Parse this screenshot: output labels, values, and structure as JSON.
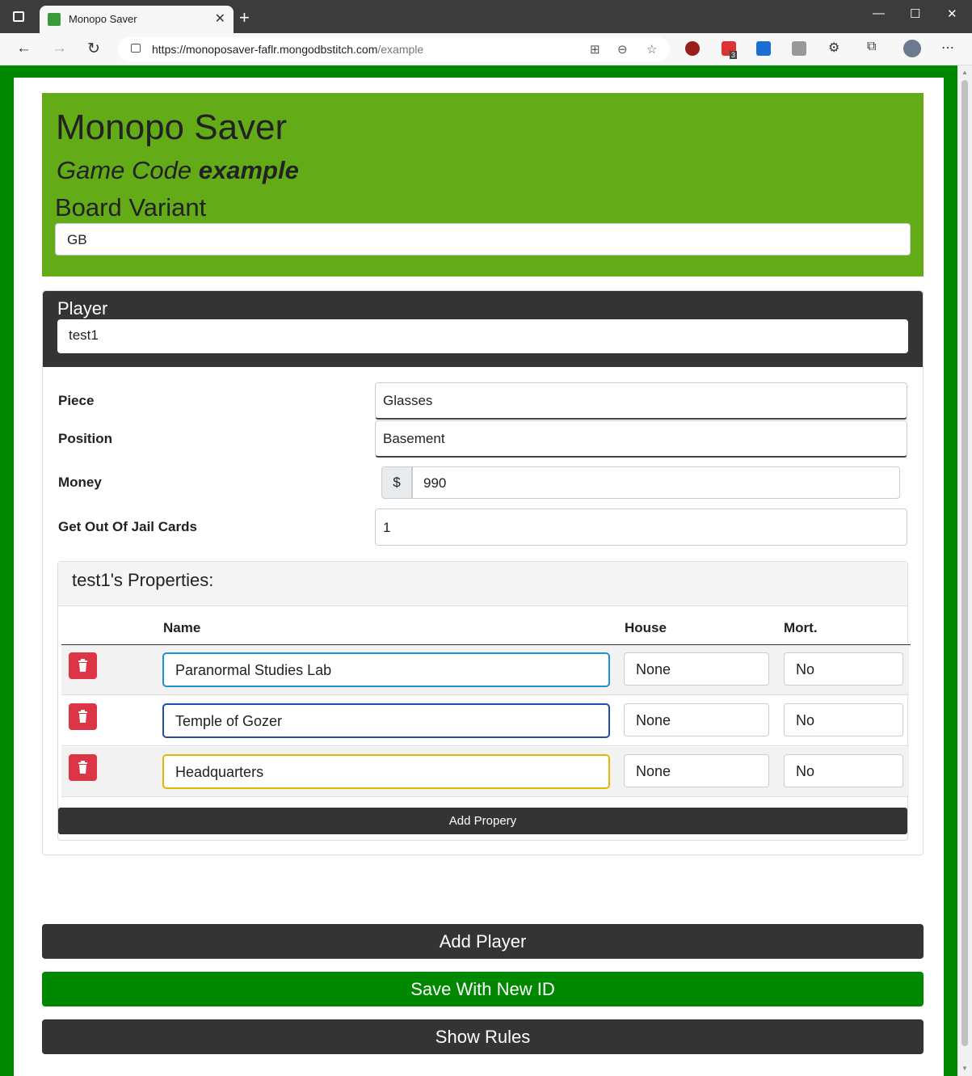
{
  "browser": {
    "tab_title": "Monopo Saver",
    "url_host": "https://monoposaver-faflr.mongodbstitch.com",
    "url_path": "/example",
    "extension_badge": "3"
  },
  "app": {
    "title": "Monopo Saver",
    "game_code_label": "Game Code",
    "game_code": "example",
    "board_variant_label": "Board Variant",
    "board_variant": "GB"
  },
  "player": {
    "label": "Player",
    "name": "test1",
    "piece_label": "Piece",
    "piece": "Glasses",
    "position_label": "Position",
    "position": "Basement",
    "money_label": "Money",
    "money_prefix": "$",
    "money": "990",
    "jail_label": "Get Out Of Jail Cards",
    "jail_cards": "1",
    "properties_title": "test1's Properties:",
    "columns": {
      "name": "Name",
      "house": "House",
      "mort": "Mort."
    },
    "properties": [
      {
        "name": "Paranormal Studies Lab",
        "house": "None",
        "mort": "No",
        "border": "#1e90d6"
      },
      {
        "name": "Temple of Gozer",
        "house": "None",
        "mort": "No",
        "border": "#1e4fa0"
      },
      {
        "name": "Headquarters",
        "house": "None",
        "mort": "No",
        "border": "#e0b800"
      }
    ],
    "add_property_label": "Add Propery"
  },
  "actions": {
    "add_player": "Add Player",
    "save_new_id": "Save With New ID",
    "show_rules": "Show Rules"
  },
  "colors": {
    "page_bg": "#008800",
    "jumbotron": "#63ab17",
    "dark": "#343434",
    "delete": "#dc3545",
    "save": "#008800"
  }
}
